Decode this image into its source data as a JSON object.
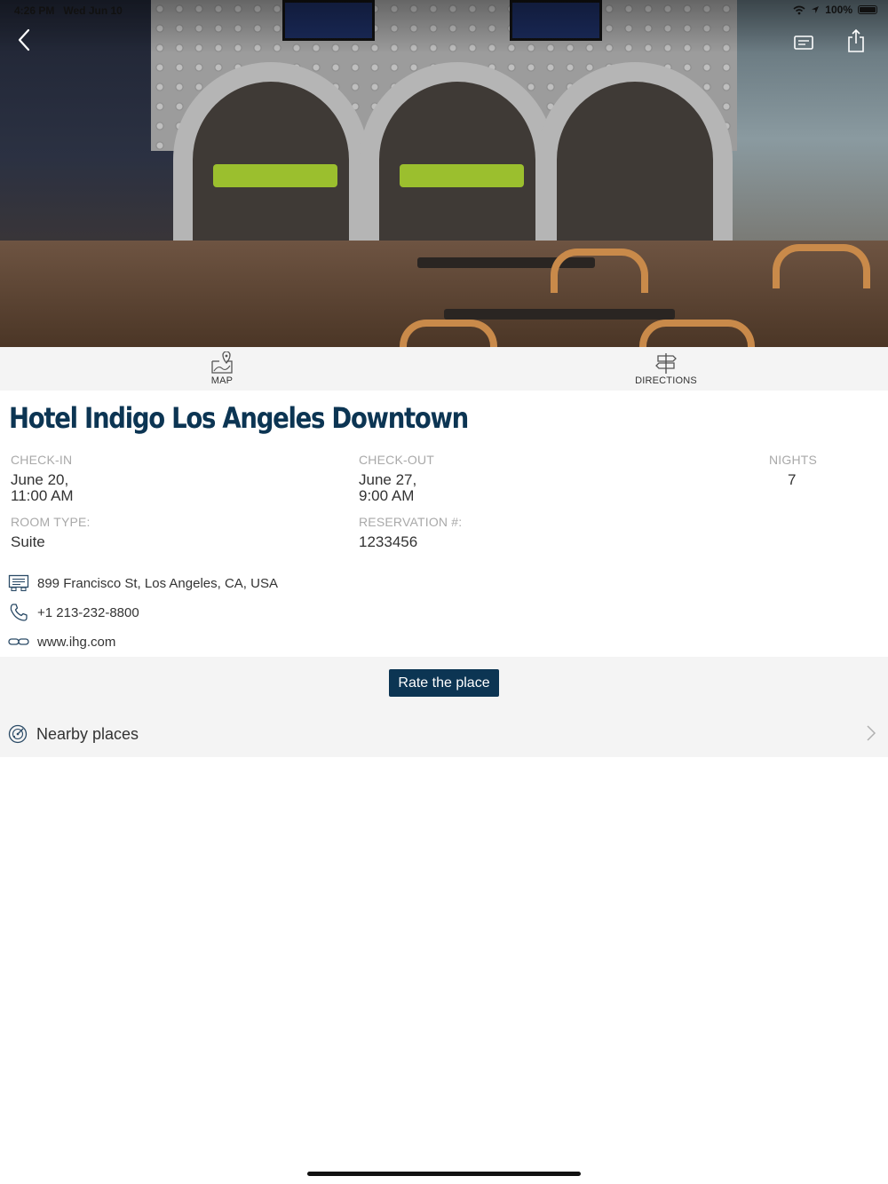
{
  "status_bar": {
    "time": "4:26 PM",
    "date": "Wed Jun 10",
    "battery": "100%",
    "icons": [
      "wifi-icon",
      "location-icon",
      "battery-icon"
    ]
  },
  "header": {
    "back_icon": "chevron-left-icon",
    "card_icon": "card-icon",
    "share_icon": "share-icon"
  },
  "actions": {
    "map_label": "MAP",
    "directions_label": "DIRECTIONS"
  },
  "hotel": {
    "name": "Hotel Indigo Los Angeles Downtown"
  },
  "booking": {
    "check_in_label": "CHECK-IN",
    "check_in_date": "June 20,",
    "check_in_time": "11:00 AM",
    "check_out_label": "CHECK-OUT",
    "check_out_date": "June 27,",
    "check_out_time": "9:00 AM",
    "nights_label": "NIGHTS",
    "nights_value": "7",
    "room_type_label": "ROOM TYPE:",
    "room_type_value": "Suite",
    "reservation_label": "RESERVATION #:",
    "reservation_value": "1233456"
  },
  "contact": {
    "address": "899 Francisco St, Los Angeles, CA, USA",
    "phone": "+1 213-232-8800",
    "website": "www.ihg.com"
  },
  "buttons": {
    "rate_label": "Rate the place"
  },
  "nearby": {
    "label": "Nearby places"
  },
  "colors": {
    "brand": "#0c3553",
    "panel_bg": "#f4f4f4",
    "label_gray": "#a9a9a9"
  }
}
